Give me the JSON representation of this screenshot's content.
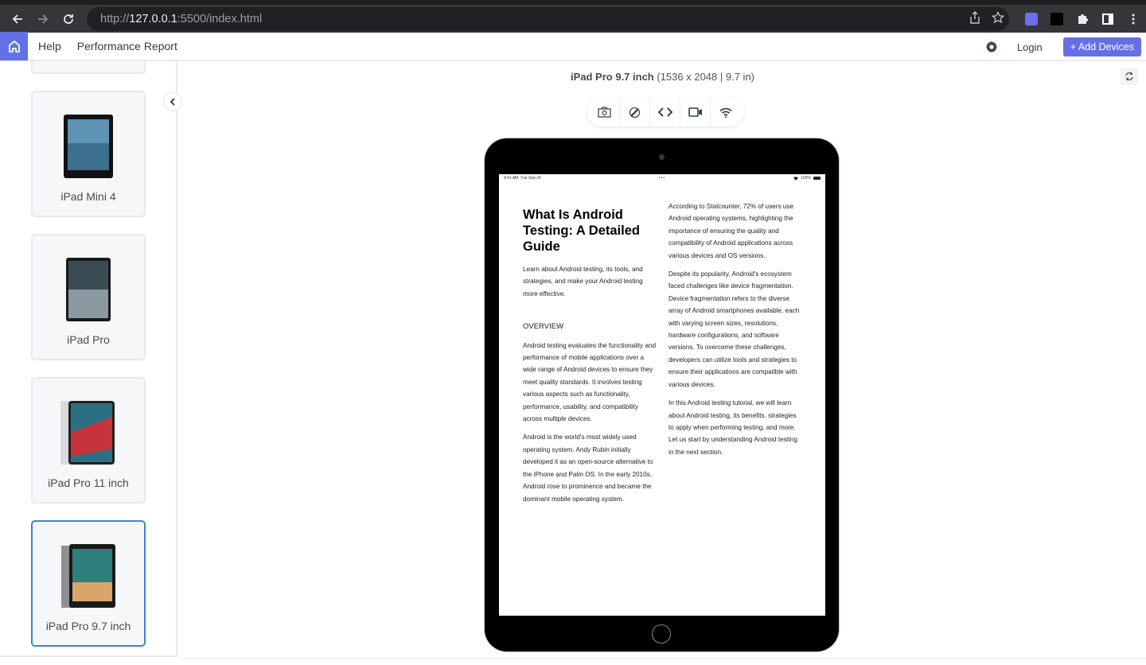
{
  "browser": {
    "url_prefix": "http://",
    "url_host": "127.0.0.1",
    "url_rest": ":5500/index.html",
    "icons": [
      "back-icon",
      "forward-icon",
      "reload-icon",
      "share-icon",
      "star-icon",
      "extension-icon",
      "puzzle-icon",
      "side-panel-icon",
      "more-icon"
    ]
  },
  "header": {
    "nav": [
      "Help",
      "Performance Report"
    ],
    "login": "Login",
    "add_devices": "+ Add Devices",
    "accent": "#6470e6"
  },
  "sidebar": {
    "devices": [
      {
        "name": "iPad Mini 4",
        "selected": false
      },
      {
        "name": "iPad Pro",
        "selected": false
      },
      {
        "name": "iPad Pro 11 inch",
        "selected": false
      },
      {
        "name": "iPad Pro 9.7 inch",
        "selected": true
      }
    ]
  },
  "device": {
    "name": "iPad Pro 9.7 inch",
    "spec": "(1536 x 2048 | 9.7 in)",
    "toolbar": [
      "camera-icon",
      "rotate-icon",
      "code-icon",
      "video-icon",
      "wifi-icon"
    ]
  },
  "screen": {
    "status": {
      "time": "9:41 AM",
      "date": "Tue Sep 24",
      "dots": "•••",
      "battery": "100%"
    },
    "title": "What Is Android Testing: A Detailed Guide",
    "lead": "Learn about Android testing, its tools, and strategies, and make your Android testing more effective.",
    "overview_heading": "OVERVIEW",
    "col1_paragraphs": [
      "Android testing evaluates the functionality and performance of mobile applications over a wide range of Android devices to ensure they meet quality standards. It involves testing various aspects such as functionality, performance, usability, and compatibility across multiple devices.",
      "Android is the world's most widely used operating system. Andy Rubin initially developed it as an open-source alternative to the iPhone and Palm OS. In the early 2010s, Android rose to prominence and became the dominant mobile operating system."
    ],
    "col2_paragraphs": [
      "According to Statcounter, 72% of users use Android operating systems, highlighting the importance of ensuring the quality and compatibility of Android applications across various devices and OS versions.",
      "Despite its popularity, Android's ecosystem faced challenges like device fragmentation. Device fragmentation refers to the diverse array of Android smartphones available, each with varying screen sizes, resolutions, hardware configurations, and software versions. To overcome these challenges, developers can utilize tools and strategies to ensure their applications are compatible with various devices.",
      "In this Android testing tutorial, we will learn about Android testing, its benefits, strategies to apply when performing testing, and more. Let us start by understanding Android testing in the next section."
    ]
  }
}
